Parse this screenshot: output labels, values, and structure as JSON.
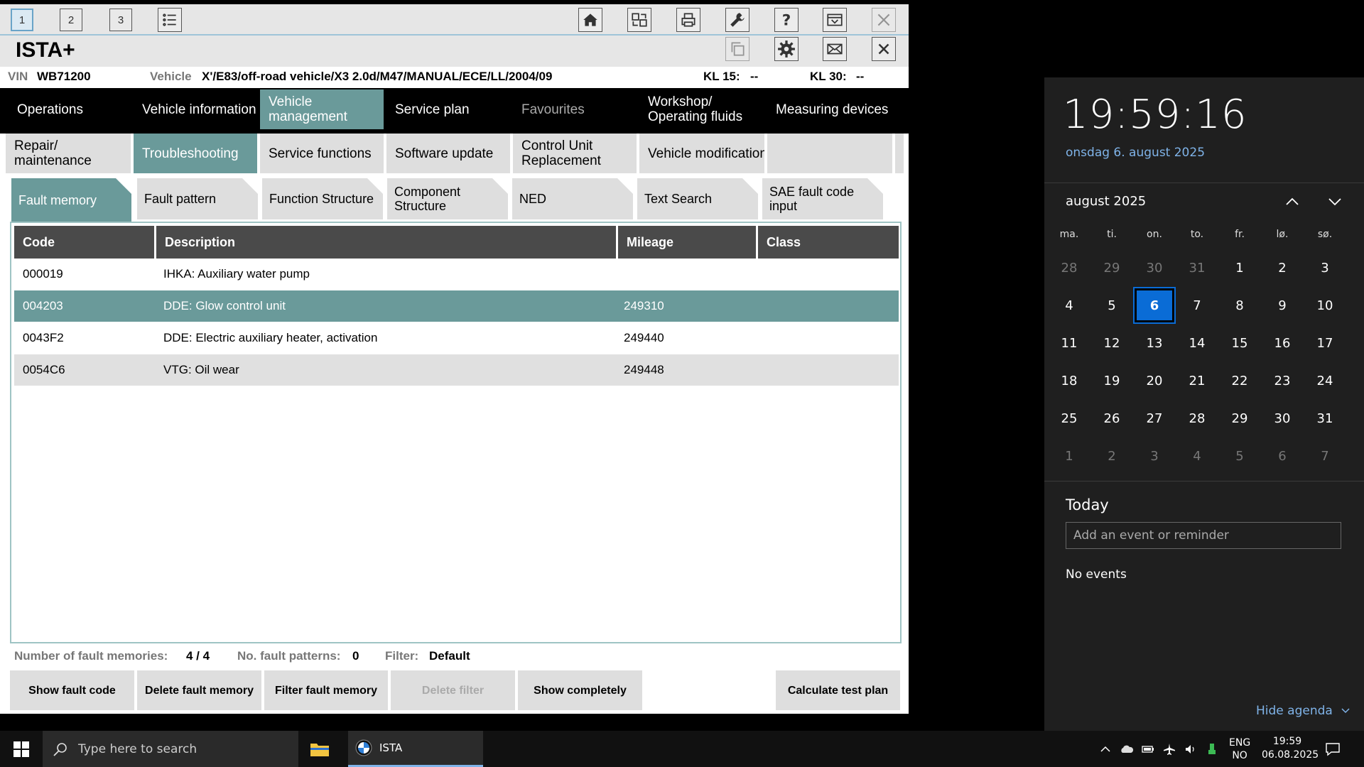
{
  "ista": {
    "window_tabs": [
      "1",
      "2",
      "3"
    ],
    "app_title": "ISTA+",
    "vin_label": "VIN",
    "vin_value": "WB71200",
    "vehicle_label": "Vehicle",
    "vehicle_value": "X'/E83/off-road vehicle/X3 2.0d/M47/MANUAL/ECE/LL/2004/09",
    "kl15_label": "KL 15:",
    "kl15_value": "--",
    "kl30_label": "KL 30:",
    "kl30_value": "--",
    "main_nav": [
      {
        "label": "Operations"
      },
      {
        "label": "Vehicle information"
      },
      {
        "label": "Vehicle management"
      },
      {
        "label": "Service plan"
      },
      {
        "label": "Favourites"
      },
      {
        "label": "Workshop/ Operating fluids"
      },
      {
        "label": "Measuring devices"
      }
    ],
    "sub_nav": [
      {
        "label": "Repair/ maintenance"
      },
      {
        "label": "Troubleshooting"
      },
      {
        "label": "Service functions"
      },
      {
        "label": "Software update"
      },
      {
        "label": "Control Unit Replacement"
      },
      {
        "label": "Vehicle modification"
      }
    ],
    "tabs": [
      {
        "label": "Fault memory"
      },
      {
        "label": "Fault pattern"
      },
      {
        "label": "Function Structure"
      },
      {
        "label": "Component Structure"
      },
      {
        "label": "NED"
      },
      {
        "label": "Text Search"
      },
      {
        "label": "SAE fault code input"
      }
    ],
    "table": {
      "headers": [
        "Code",
        "Description",
        "Mileage",
        "Class"
      ],
      "rows": [
        {
          "code": "000019",
          "desc": "IHKA: Auxiliary water pump",
          "mileage": "",
          "class": ""
        },
        {
          "code": "004203",
          "desc": "DDE: Glow control unit",
          "mileage": "249310",
          "class": ""
        },
        {
          "code": "0043F2",
          "desc": "DDE: Electric auxiliary heater, activation",
          "mileage": "249440",
          "class": ""
        },
        {
          "code": "0054C6",
          "desc": "VTG: Oil wear",
          "mileage": "249448",
          "class": ""
        }
      ]
    },
    "status": {
      "fault_memories_label": "Number of fault memories:",
      "fault_memories_value": "4 / 4",
      "fault_patterns_label": "No. fault patterns:",
      "fault_patterns_value": "0",
      "filter_label": "Filter:",
      "filter_value": "Default"
    },
    "buttons": {
      "show_fault_code": "Show fault code",
      "delete_fault_memory": "Delete fault memory",
      "filter_fault_memory": "Filter fault memory",
      "delete_filter": "Delete filter",
      "show_completely": "Show completely",
      "calculate_test_plan": "Calculate test plan"
    }
  },
  "calendar": {
    "time": "19:59:16",
    "date_long": "onsdag 6. august 2025",
    "month": "august 2025",
    "weekdays": [
      "ma.",
      "ti.",
      "on.",
      "to.",
      "fr.",
      "lø.",
      "sø."
    ],
    "days": [
      "28",
      "29",
      "30",
      "31",
      "1",
      "2",
      "3",
      "4",
      "5",
      "6",
      "7",
      "8",
      "9",
      "10",
      "11",
      "12",
      "13",
      "14",
      "15",
      "16",
      "17",
      "18",
      "19",
      "20",
      "21",
      "22",
      "23",
      "24",
      "25",
      "26",
      "27",
      "28",
      "29",
      "30",
      "31",
      "1",
      "2",
      "3",
      "4",
      "5",
      "6",
      "7"
    ],
    "today_label": "Today",
    "event_placeholder": "Add an event or reminder",
    "no_events": "No events",
    "hide_agenda": "Hide agenda"
  },
  "taskbar": {
    "search_placeholder": "Type here to search",
    "ista_app_label": "ISTA",
    "lang_top": "ENG",
    "lang_bottom": "NO",
    "time": "19:59",
    "date": "06.08.2025"
  }
}
